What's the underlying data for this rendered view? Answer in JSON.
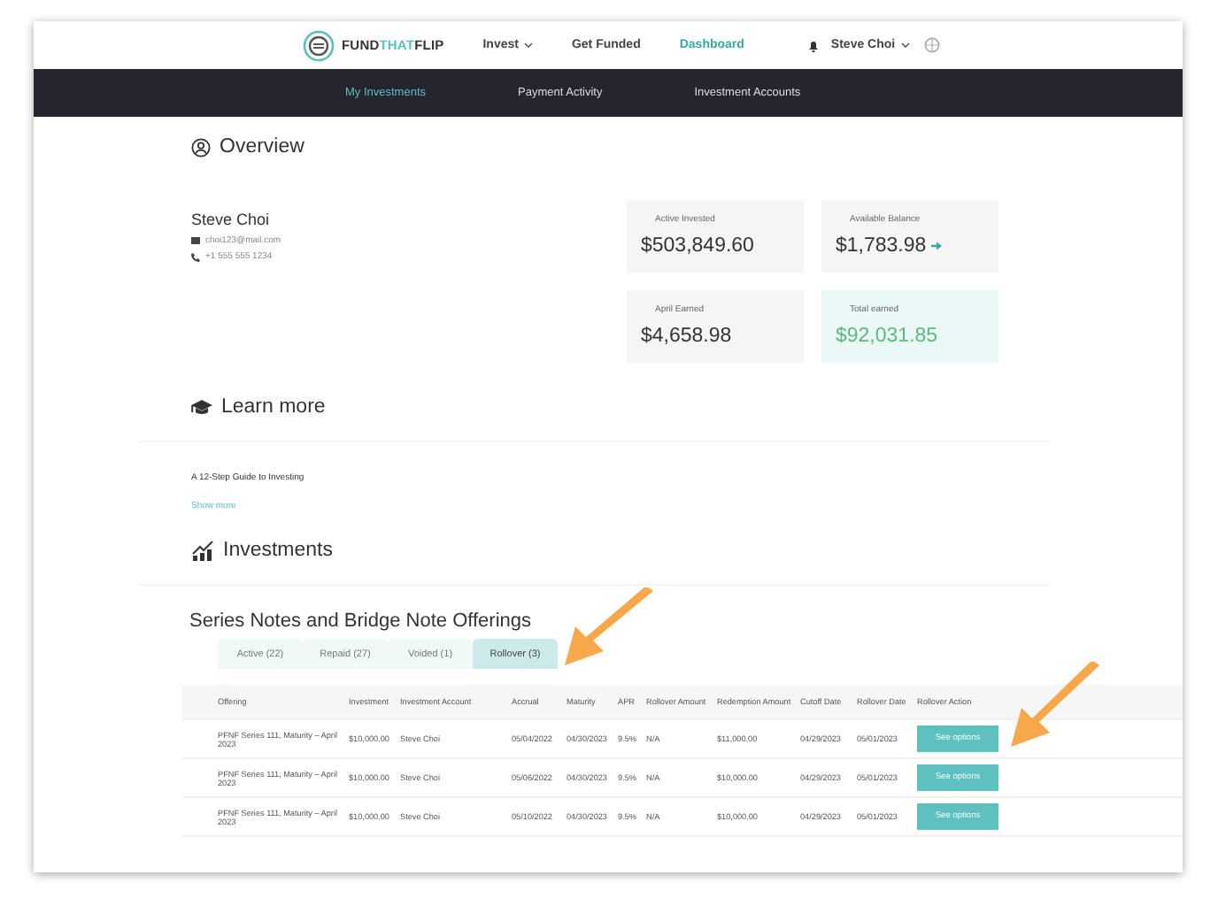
{
  "header": {
    "logo": {
      "part_1": "FUND",
      "part_2": "THAT",
      "part_3": "FLIP"
    },
    "links": [
      {
        "label": "Invest",
        "dropdown": true,
        "selected": false
      },
      {
        "label": "Get Funded",
        "dropdown": false,
        "selected": false
      },
      {
        "label": "Dashboard",
        "dropdown": false,
        "selected": true
      }
    ],
    "user": "Steve Choi"
  },
  "subnav": [
    {
      "label": "My Investments",
      "selected": true
    },
    {
      "label": "Payment Activity",
      "selected": false
    },
    {
      "label": "Investment Accounts",
      "selected": false
    }
  ],
  "overview": {
    "title": "Overview",
    "name": "Steve Choi",
    "email": "choi123@mail.com",
    "phone": "+1 555 555 1234",
    "cards": [
      {
        "label": "Active Invested",
        "value": "$503,849.60",
        "kind": "plain"
      },
      {
        "label": "Available Balance",
        "value": "$1,783.98",
        "kind": "arrow"
      },
      {
        "label": "April Earned",
        "value": "$4,658.98",
        "kind": "plain"
      },
      {
        "label": "Total earned",
        "value": "$92,031.85",
        "kind": "highlight"
      }
    ]
  },
  "learn_more": {
    "title": "Learn more",
    "item": "A 12-Step Guide to Investing",
    "link": "Show more"
  },
  "investments": {
    "title": "Investments"
  },
  "offerings": {
    "title": "Series Notes and Bridge Note Offerings",
    "tabs": [
      {
        "label": "Active (22)",
        "selected": false
      },
      {
        "label": "Repaid (27)",
        "selected": false
      },
      {
        "label": "Voided (1)",
        "selected": false
      },
      {
        "label": "Rollover (3)",
        "selected": true
      }
    ],
    "table": {
      "columns": [
        "Offering",
        "Investment",
        "Investment Account",
        "Accrual",
        "Maturity",
        "APR",
        "Rollover Amount",
        "Redemption Amount",
        "Cutoff Date",
        "Rollover Date",
        "Rollover Action"
      ],
      "rows": [
        {
          "cells": [
            "PFNF Series 111, Maturity – April 2023",
            "$10,000.00",
            "Steve Choi",
            "05/04/2022",
            "04/30/2023",
            "9.5%",
            "N/A",
            "$11,000.00",
            "04/29/2023",
            "05/01/2023"
          ],
          "action": "See options"
        },
        {
          "cells": [
            "PFNF Series 111, Maturity – April 2023",
            "$10,000.00",
            "Steve Choi",
            "05/06/2022",
            "04/30/2023",
            "9.5%",
            "N/A",
            "$10,000.00",
            "04/29/2023",
            "05/01/2023"
          ],
          "action": "See options"
        },
        {
          "cells": [
            "PFNF Series 111, Maturity – April 2023",
            "$10,000.00",
            "Steve Choi",
            "05/10/2022",
            "04/30/2023",
            "9.5%",
            "N/A",
            "$10,000.00",
            "04/29/2023",
            "05/01/2023"
          ],
          "action": "See options"
        }
      ]
    }
  }
}
